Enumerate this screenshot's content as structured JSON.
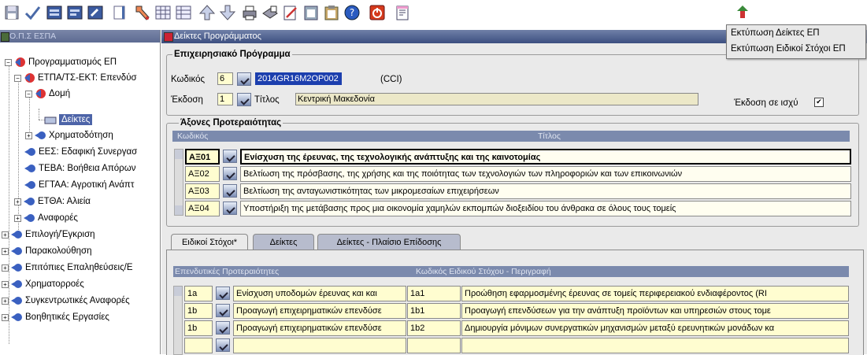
{
  "toolbar": {
    "icons": [
      "save-icon",
      "accept-icon",
      "form-icon",
      "form-icon",
      "tool-icon",
      "blank-icon",
      "edit-icon",
      "grid-icon",
      "grid-icon",
      "up-icon",
      "down-icon",
      "print-icon",
      "print2-icon",
      "edit-doc-icon",
      "paste-icon",
      "clipboard-icon",
      "help-icon",
      "exit-icon",
      "notes-icon",
      "print-menu-icon"
    ]
  },
  "print_menu": {
    "items": [
      "Εκτύπωση Δείκτες ΕΠ",
      "Εκτύπωση Ειδικοί Στόχοι ΕΠ"
    ]
  },
  "navigator": {
    "title": "Ο.Π.Σ ΕΣΠΑ",
    "items": [
      {
        "label": "Προγραμματισμός ΕΠ",
        "expand": "−"
      },
      {
        "label": "ΕΤΠΑ/ΤΣ-ΕΚΤ: Επενδύσ",
        "expand": "−"
      },
      {
        "label": "Δομή",
        "expand": "−"
      },
      {
        "label": "Δείκτες",
        "expand": ""
      },
      {
        "label": "Χρηματοδότηση",
        "expand": "+"
      },
      {
        "label": "ΕΕΣ: Εδαφική Συνεργασ",
        "expand": ""
      },
      {
        "label": "ΤΕΒΑ: Βοήθεια Απόρων",
        "expand": ""
      },
      {
        "label": "ΕΓΤΑΑ: Αγροτική Ανάπτ",
        "expand": ""
      },
      {
        "label": "ΕΤΘΑ: Αλιεία",
        "expand": "+"
      },
      {
        "label": "Αναφορές",
        "expand": "+"
      },
      {
        "label": "Επιλογή/Έγκριση",
        "expand": "+"
      },
      {
        "label": "Παρακολούθηση",
        "expand": "+"
      },
      {
        "label": "Επιτόπιες Επαληθεύσεις/Ε",
        "expand": "+"
      },
      {
        "label": "Χρηματορροές",
        "expand": "+"
      },
      {
        "label": "Συγκεντρωτικές Αναφορές",
        "expand": "+"
      },
      {
        "label": "Βοηθητικές Εργασίες",
        "expand": "+"
      }
    ]
  },
  "window": {
    "title": "Δείκτες Προγράμματος"
  },
  "program": {
    "frame_label": "Επιχειρησιακό Πρόγραμμα",
    "code_label": "Κωδικός",
    "code_value": "6",
    "cci_value": "2014GR16M2OP002",
    "cci_label": "(CCI)",
    "version_label": "Έκδοση",
    "version_value": "1",
    "title_label": "Τίτλος",
    "title_value": "Κεντρική Μακεδονία",
    "valid_label": "Έκδοση σε ισχύ",
    "valid_checked": "✔"
  },
  "axes": {
    "frame_label": "Άξονες Προτεραιότητας",
    "headers": [
      "Κωδικός",
      "Τίτλος"
    ],
    "rows": [
      {
        "code": "ΑΞ01",
        "title": "Ενίσχυση της έρευνας, της τεχνολογικής ανάπτυξης και της καινοτομίας"
      },
      {
        "code": "ΑΞ02",
        "title": "Βελτίωση της πρόσβασης, της χρήσης και της ποιότητας των τεχνολογιών των πληροφοριών και των επικοινωνιών"
      },
      {
        "code": "ΑΞ03",
        "title": "Βελτίωση της ανταγωνιστικότητας των μικρομεσαίων επιχειρήσεων"
      },
      {
        "code": "ΑΞ04",
        "title": "Υποστήριξη της μετάβασης προς μια οικονομία χαμηλών εκπομπών διοξειδίου του άνθρακα σε όλους τους τομείς"
      }
    ]
  },
  "tabs": [
    "Ειδικοί Στόχοι*",
    "Δείκτες",
    "Δείκτες - Πλαίσιο Επίδοσης"
  ],
  "objectives": {
    "headers": [
      "Επενδυτικές Προτεραιότητες",
      "Κωδικός Ειδικού Στόχου - Περιγραφή"
    ],
    "rows": [
      {
        "prio": "1a",
        "prio_text": "Ενίσχυση υποδομών έρευνας και και",
        "code": "1a1",
        "desc": "Προώθηση εφαρμοσμένης έρευνας σε τομείς περιφερειακού ενδιαφέροντος (RI"
      },
      {
        "prio": "1b",
        "prio_text": "Προαγωγή επιχειρηματικών επενδύσε",
        "code": "1b1",
        "desc": "Προαγωγή επενδύσεων για την ανάπτυξη προϊόντων και υπηρεσιών στους τομε"
      },
      {
        "prio": "1b",
        "prio_text": "Προαγωγή επιχειρηματικών επενδύσε",
        "code": "1b2",
        "desc": "Δημιουργία μόνιμων συνεργατικών μηχανισμών μεταξύ ερευνητικών μονάδων κα"
      },
      {
        "prio": "",
        "prio_text": "",
        "code": "",
        "desc": ""
      }
    ]
  },
  "colors": {
    "accent": "#4d64a8",
    "header": "#7b8aad",
    "field_yellow": "#fffdd0"
  }
}
